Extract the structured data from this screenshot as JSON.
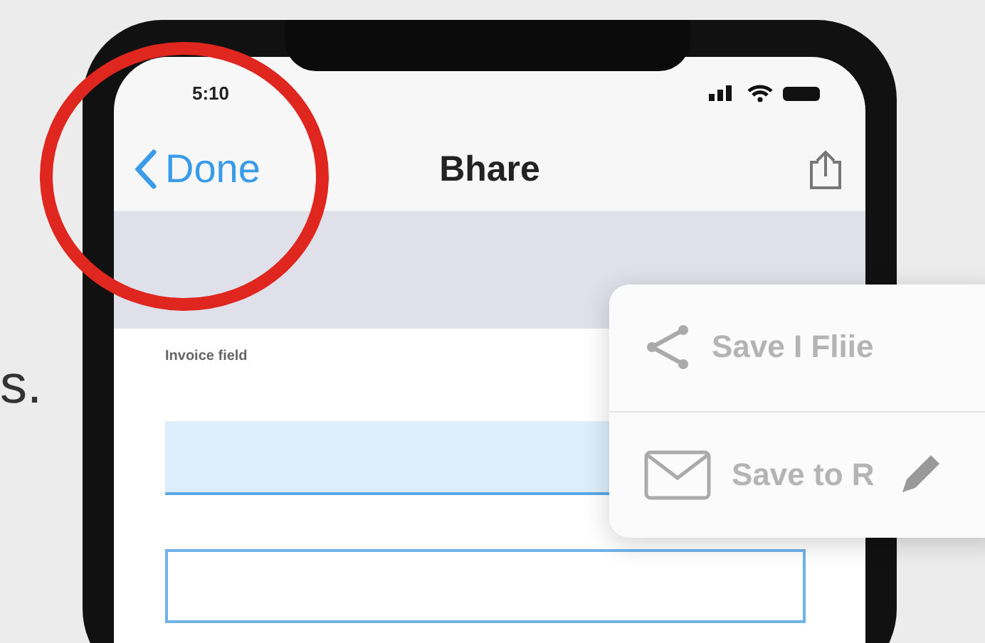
{
  "background_text": "s.",
  "status_bar": {
    "time": "5:10"
  },
  "nav_bar": {
    "back_label": "Done",
    "title": "Bhare"
  },
  "form": {
    "field_label": "Invoice field",
    "fields": [
      {
        "kind": "filled"
      },
      {
        "kind": "outlined"
      }
    ]
  },
  "menu": {
    "items": [
      {
        "kind": "share",
        "label": "Save I Fliie"
      },
      {
        "kind": "mail",
        "label": "Save to R"
      }
    ]
  }
}
